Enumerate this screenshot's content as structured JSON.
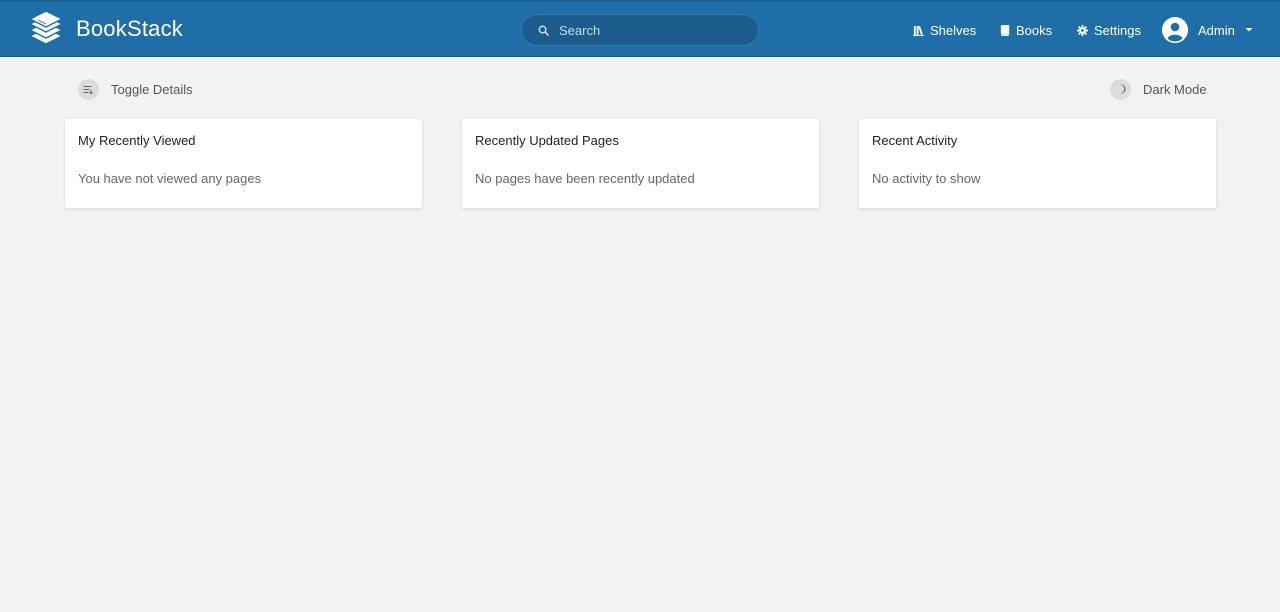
{
  "app": {
    "name": "BookStack",
    "brand_color": "#206ea7"
  },
  "search": {
    "placeholder": "Search"
  },
  "nav": {
    "shelves": "Shelves",
    "books": "Books",
    "settings": "Settings",
    "user": "Admin"
  },
  "toolbar": {
    "toggle_details": "Toggle Details",
    "dark_mode": "Dark Mode"
  },
  "cards": [
    {
      "title": "My Recently Viewed",
      "empty_text": "You have not viewed any pages"
    },
    {
      "title": "Recently Updated Pages",
      "empty_text": "No pages have been recently updated"
    },
    {
      "title": "Recent Activity",
      "empty_text": "No activity to show"
    }
  ]
}
